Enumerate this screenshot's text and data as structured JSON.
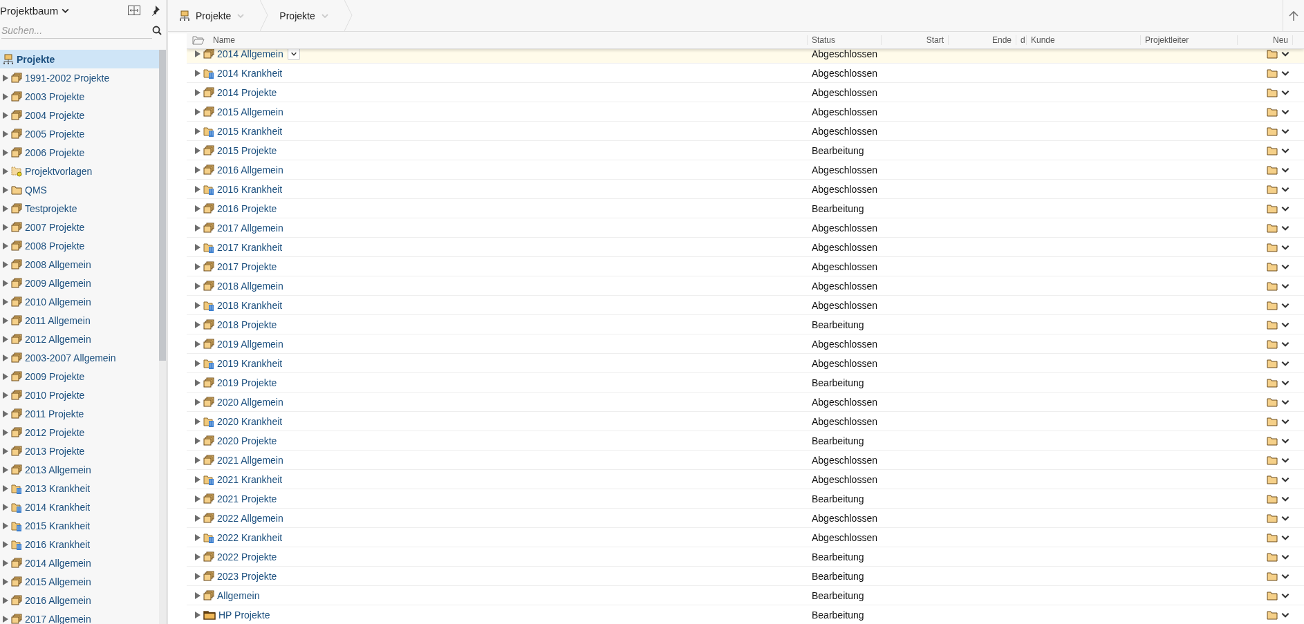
{
  "sidebar": {
    "title": "Projektbaum",
    "search": {
      "placeholder": "Suchen..."
    },
    "items": [
      {
        "label": "Projekte",
        "kind": "root",
        "selected": true
      },
      {
        "label": "1991-2002 Projekte",
        "kind": "stack",
        "selected": false
      },
      {
        "label": "2003 Projekte",
        "kind": "stack",
        "selected": false
      },
      {
        "label": "2004 Projekte",
        "kind": "stack",
        "selected": false
      },
      {
        "label": "2005 Projekte",
        "kind": "stack",
        "selected": false
      },
      {
        "label": "2006 Projekte",
        "kind": "stack",
        "selected": false
      },
      {
        "label": "Projektvorlagen",
        "kind": "template",
        "selected": false
      },
      {
        "label": "QMS",
        "kind": "folder",
        "selected": false
      },
      {
        "label": "Testprojekte",
        "kind": "stack",
        "selected": false
      },
      {
        "label": "2007 Projekte",
        "kind": "stack",
        "selected": false
      },
      {
        "label": "2008 Projekte",
        "kind": "stack",
        "selected": false
      },
      {
        "label": "2008 Allgemein",
        "kind": "stack",
        "selected": false
      },
      {
        "label": "2009 Allgemein",
        "kind": "stack",
        "selected": false
      },
      {
        "label": "2010 Allgemein",
        "kind": "stack",
        "selected": false
      },
      {
        "label": "2011 Allgemein",
        "kind": "stack",
        "selected": false
      },
      {
        "label": "2012 Allgemein",
        "kind": "stack",
        "selected": false
      },
      {
        "label": "2003-2007 Allgemein",
        "kind": "stack",
        "selected": false
      },
      {
        "label": "2009 Projekte",
        "kind": "stack",
        "selected": false
      },
      {
        "label": "2010 Projekte",
        "kind": "stack",
        "selected": false
      },
      {
        "label": "2011 Projekte",
        "kind": "stack",
        "selected": false
      },
      {
        "label": "2012 Projekte",
        "kind": "stack",
        "selected": false
      },
      {
        "label": "2013 Projekte",
        "kind": "stack",
        "selected": false
      },
      {
        "label": "2013 Allgemein",
        "kind": "stack",
        "selected": false
      },
      {
        "label": "2013 Krankheit",
        "kind": "building",
        "selected": false
      },
      {
        "label": "2014 Krankheit",
        "kind": "building",
        "selected": false
      },
      {
        "label": "2015 Krankheit",
        "kind": "building",
        "selected": false
      },
      {
        "label": "2016 Krankheit",
        "kind": "building",
        "selected": false
      },
      {
        "label": "2014 Allgemein",
        "kind": "stack",
        "selected": false
      },
      {
        "label": "2015 Allgemein",
        "kind": "stack",
        "selected": false
      },
      {
        "label": "2016 Allgemein",
        "kind": "stack",
        "selected": false
      },
      {
        "label": "2017 Allgemein",
        "kind": "stack",
        "selected": false
      }
    ]
  },
  "breadcrumbs": [
    {
      "label": "Projekte",
      "kind": "root"
    },
    {
      "label": "Projekte",
      "kind": "plain"
    }
  ],
  "table": {
    "columns": [
      {
        "label": "Name"
      },
      {
        "label": "Status"
      },
      {
        "label": "Start"
      },
      {
        "label": "Ende"
      },
      {
        "label": "d"
      },
      {
        "label": "Kunde"
      },
      {
        "label": "Projektleiter"
      },
      {
        "label": "Neu"
      }
    ],
    "rows": [
      {
        "name": "2014 Allgemein",
        "kind": "stack",
        "status": "Abgeschlossen",
        "selected": true
      },
      {
        "name": "2014 Krankheit",
        "kind": "building",
        "status": "Abgeschlossen",
        "selected": false
      },
      {
        "name": "2014 Projekte",
        "kind": "stack",
        "status": "Abgeschlossen",
        "selected": false
      },
      {
        "name": "2015 Allgemein",
        "kind": "stack",
        "status": "Abgeschlossen",
        "selected": false
      },
      {
        "name": "2015 Krankheit",
        "kind": "building",
        "status": "Abgeschlossen",
        "selected": false
      },
      {
        "name": "2015 Projekte",
        "kind": "stack",
        "status": "Bearbeitung",
        "selected": false
      },
      {
        "name": "2016 Allgemein",
        "kind": "stack",
        "status": "Abgeschlossen",
        "selected": false
      },
      {
        "name": "2016 Krankheit",
        "kind": "building",
        "status": "Abgeschlossen",
        "selected": false
      },
      {
        "name": "2016 Projekte",
        "kind": "stack",
        "status": "Bearbeitung",
        "selected": false
      },
      {
        "name": "2017 Allgemein",
        "kind": "stack",
        "status": "Abgeschlossen",
        "selected": false
      },
      {
        "name": "2017 Krankheit",
        "kind": "building",
        "status": "Abgeschlossen",
        "selected": false
      },
      {
        "name": "2017 Projekte",
        "kind": "stack",
        "status": "Abgeschlossen",
        "selected": false
      },
      {
        "name": "2018 Allgemein",
        "kind": "stack",
        "status": "Abgeschlossen",
        "selected": false
      },
      {
        "name": "2018 Krankheit",
        "kind": "building",
        "status": "Abgeschlossen",
        "selected": false
      },
      {
        "name": "2018 Projekte",
        "kind": "stack",
        "status": "Bearbeitung",
        "selected": false
      },
      {
        "name": "2019 Allgemein",
        "kind": "stack",
        "status": "Abgeschlossen",
        "selected": false
      },
      {
        "name": "2019 Krankheit",
        "kind": "building",
        "status": "Abgeschlossen",
        "selected": false
      },
      {
        "name": "2019 Projekte",
        "kind": "stack",
        "status": "Bearbeitung",
        "selected": false
      },
      {
        "name": "2020 Allgemein",
        "kind": "stack",
        "status": "Abgeschlossen",
        "selected": false
      },
      {
        "name": "2020 Krankheit",
        "kind": "building",
        "status": "Abgeschlossen",
        "selected": false
      },
      {
        "name": "2020 Projekte",
        "kind": "stack",
        "status": "Bearbeitung",
        "selected": false
      },
      {
        "name": "2021 Allgemein",
        "kind": "stack",
        "status": "Abgeschlossen",
        "selected": false
      },
      {
        "name": "2021 Krankheit",
        "kind": "building",
        "status": "Abgeschlossen",
        "selected": false
      },
      {
        "name": "2021 Projekte",
        "kind": "stack",
        "status": "Bearbeitung",
        "selected": false
      },
      {
        "name": "2022 Allgemein",
        "kind": "stack",
        "status": "Abgeschlossen",
        "selected": false
      },
      {
        "name": "2022 Krankheit",
        "kind": "building",
        "status": "Abgeschlossen",
        "selected": false
      },
      {
        "name": "2022 Projekte",
        "kind": "stack",
        "status": "Bearbeitung",
        "selected": false
      },
      {
        "name": "2023 Projekte",
        "kind": "stack",
        "status": "Bearbeitung",
        "selected": false
      },
      {
        "name": "Allgemein",
        "kind": "stack",
        "status": "Bearbeitung",
        "selected": false
      },
      {
        "name": "HP Projekte",
        "kind": "dark-folder",
        "status": "Bearbeitung",
        "selected": false
      }
    ]
  }
}
